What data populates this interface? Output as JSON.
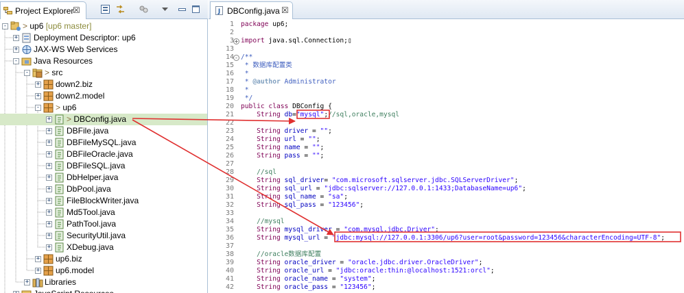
{
  "explorer": {
    "tab_title": "Project Explorer",
    "tab_close": "☒",
    "tree": [
      {
        "label": "up6",
        "suffix": " [up6 master]",
        "prefix": "> ",
        "icon": "project-icon",
        "expander": "-",
        "level": 0
      },
      {
        "label": "Deployment Descriptor: up6",
        "icon": "deployment-descriptor-icon",
        "expander": "+",
        "level": 1
      },
      {
        "label": "JAX-WS Web Services",
        "icon": "web-services-icon",
        "expander": "+",
        "level": 1
      },
      {
        "label": "Java Resources",
        "icon": "java-resources-icon",
        "expander": "-",
        "level": 1
      },
      {
        "label": "src",
        "prefix": "> ",
        "icon": "source-folder-icon",
        "expander": "-",
        "level": 2
      },
      {
        "label": "down2.biz",
        "icon": "package-icon",
        "expander": "+",
        "level": 3
      },
      {
        "label": "down2.model",
        "icon": "package-icon",
        "expander": "+",
        "level": 3
      },
      {
        "label": "up6",
        "prefix": "> ",
        "icon": "package-icon",
        "expander": "-",
        "level": 3
      },
      {
        "label": "DBConfig.java",
        "prefix": "> ",
        "icon": "java-file-icon",
        "expander": "+",
        "level": 4,
        "selected": true
      },
      {
        "label": "DBFile.java",
        "icon": "java-file-icon",
        "expander": "+",
        "level": 4
      },
      {
        "label": "DBFileMySQL.java",
        "icon": "java-file-icon",
        "expander": "+",
        "level": 4
      },
      {
        "label": "DBFileOracle.java",
        "icon": "java-file-icon",
        "expander": "+",
        "level": 4
      },
      {
        "label": "DBFileSQL.java",
        "icon": "java-file-icon",
        "expander": "+",
        "level": 4
      },
      {
        "label": "DbHelper.java",
        "icon": "java-file-icon",
        "expander": "+",
        "level": 4
      },
      {
        "label": "DbPool.java",
        "icon": "java-file-icon",
        "expander": "+",
        "level": 4
      },
      {
        "label": "FileBlockWriter.java",
        "icon": "java-file-icon",
        "expander": "+",
        "level": 4
      },
      {
        "label": "Md5Tool.java",
        "icon": "java-file-icon",
        "expander": "+",
        "level": 4
      },
      {
        "label": "PathTool.java",
        "icon": "java-file-icon",
        "expander": "+",
        "level": 4
      },
      {
        "label": "SecurityUtil.java",
        "icon": "java-file-icon",
        "expander": "+",
        "level": 4
      },
      {
        "label": "XDebug.java",
        "icon": "java-file-icon",
        "expander": "+",
        "level": 4
      },
      {
        "label": "up6.biz",
        "icon": "package-icon",
        "expander": "+",
        "level": 3
      },
      {
        "label": "up6.model",
        "icon": "package-icon",
        "expander": "+",
        "level": 3
      },
      {
        "label": "Libraries",
        "icon": "libraries-icon",
        "expander": "+",
        "level": 2
      },
      {
        "label": "JavaScript Resources",
        "icon": "javascript-resources-icon",
        "expander": "+",
        "level": 1
      }
    ]
  },
  "editor": {
    "tab_title": "DBConfig.java",
    "tab_close": "☒",
    "lines": [
      {
        "n": "1",
        "tokens": [
          [
            "kw",
            "package"
          ],
          [
            "tx",
            " up6;"
          ]
        ]
      },
      {
        "n": "2",
        "tokens": []
      },
      {
        "n": "3",
        "fold": "+",
        "tokens": [
          [
            "kw",
            "import"
          ],
          [
            "tx",
            " java.sql.Connection;"
          ],
          [
            "tx",
            "▯"
          ]
        ]
      },
      {
        "n": "13",
        "tokens": []
      },
      {
        "n": "14",
        "fold": "-",
        "tokens": [
          [
            "jd",
            "/**"
          ]
        ]
      },
      {
        "n": "15",
        "tokens": [
          [
            "jd",
            " * 数据库配置类"
          ]
        ]
      },
      {
        "n": "16",
        "tokens": [
          [
            "jd",
            " *"
          ]
        ]
      },
      {
        "n": "17",
        "tokens": [
          [
            "jd",
            " * "
          ],
          [
            "ann",
            "@author"
          ],
          [
            "jd",
            " Administrator"
          ]
        ]
      },
      {
        "n": "18",
        "tokens": [
          [
            "jd",
            " *"
          ]
        ]
      },
      {
        "n": "19",
        "tokens": [
          [
            "jd",
            " */"
          ]
        ]
      },
      {
        "n": "20",
        "tokens": [
          [
            "kw",
            "public class"
          ],
          [
            "tx",
            " DBConfig {"
          ]
        ]
      },
      {
        "n": "21",
        "tokens": [
          [
            "tx",
            "    "
          ],
          [
            "kw",
            "String"
          ],
          [
            "fld",
            " db"
          ],
          [
            "tx",
            "="
          ],
          [
            "str",
            "\"mysql\""
          ],
          [
            "tx",
            ";"
          ],
          [
            "cm",
            "//sql,oracle,mysql"
          ]
        ]
      },
      {
        "n": "22",
        "tokens": []
      },
      {
        "n": "23",
        "tokens": [
          [
            "tx",
            "    "
          ],
          [
            "kw",
            "String"
          ],
          [
            "fld",
            " driver"
          ],
          [
            "tx",
            " = "
          ],
          [
            "str",
            "\"\""
          ],
          [
            "tx",
            ";"
          ]
        ]
      },
      {
        "n": "24",
        "tokens": [
          [
            "tx",
            "    "
          ],
          [
            "kw",
            "String"
          ],
          [
            "fld",
            " url"
          ],
          [
            "tx",
            " = "
          ],
          [
            "str",
            "\"\""
          ],
          [
            "tx",
            ";"
          ]
        ]
      },
      {
        "n": "25",
        "tokens": [
          [
            "tx",
            "    "
          ],
          [
            "kw",
            "String"
          ],
          [
            "fld",
            " name"
          ],
          [
            "tx",
            " = "
          ],
          [
            "str",
            "\"\""
          ],
          [
            "tx",
            ";"
          ]
        ]
      },
      {
        "n": "26",
        "tokens": [
          [
            "tx",
            "    "
          ],
          [
            "kw",
            "String"
          ],
          [
            "fld",
            " pass"
          ],
          [
            "tx",
            " = "
          ],
          [
            "str",
            "\"\""
          ],
          [
            "tx",
            ";"
          ]
        ]
      },
      {
        "n": "27",
        "tokens": []
      },
      {
        "n": "28",
        "tokens": [
          [
            "cm",
            "    //sql"
          ]
        ]
      },
      {
        "n": "29",
        "tokens": [
          [
            "tx",
            "    "
          ],
          [
            "kw",
            "String"
          ],
          [
            "fld",
            " sql_driver"
          ],
          [
            "tx",
            "= "
          ],
          [
            "str",
            "\"com.microsoft.sqlserver.jdbc.SQLServerDriver\""
          ],
          [
            "tx",
            ";"
          ]
        ]
      },
      {
        "n": "30",
        "tokens": [
          [
            "tx",
            "    "
          ],
          [
            "kw",
            "String"
          ],
          [
            "fld",
            " sql_url"
          ],
          [
            "tx",
            " = "
          ],
          [
            "str",
            "\"jdbc:sqlserver://127.0.0.1:1433;DatabaseName=up6\""
          ],
          [
            "tx",
            ";"
          ]
        ]
      },
      {
        "n": "31",
        "tokens": [
          [
            "tx",
            "    "
          ],
          [
            "kw",
            "String"
          ],
          [
            "fld",
            " sql_name"
          ],
          [
            "tx",
            " = "
          ],
          [
            "str",
            "\"sa\""
          ],
          [
            "tx",
            ";"
          ]
        ]
      },
      {
        "n": "32",
        "tokens": [
          [
            "tx",
            "    "
          ],
          [
            "kw",
            "String"
          ],
          [
            "fld",
            " sql_pass"
          ],
          [
            "tx",
            " = "
          ],
          [
            "str",
            "\"123456\""
          ],
          [
            "tx",
            ";"
          ]
        ]
      },
      {
        "n": "33",
        "tokens": []
      },
      {
        "n": "34",
        "tokens": [
          [
            "cm",
            "    //mysql"
          ]
        ]
      },
      {
        "n": "35",
        "tokens": [
          [
            "tx",
            "    "
          ],
          [
            "kw",
            "String"
          ],
          [
            "fld",
            " mysql_driver"
          ],
          [
            "tx",
            " = "
          ],
          [
            "str",
            "\"com.mysql.jdbc.Driver\""
          ],
          [
            "tx",
            ";"
          ]
        ]
      },
      {
        "n": "36",
        "tokens": [
          [
            "tx",
            "    "
          ],
          [
            "kw",
            "String"
          ],
          [
            "fld",
            " mysql_url"
          ],
          [
            "tx",
            " = "
          ],
          [
            "str",
            "\"jdbc:mysql://127.0.0.1:3306/up6?user=root&password=123456&characterEncoding=UTF-8\""
          ],
          [
            "tx",
            ";"
          ]
        ]
      },
      {
        "n": "37",
        "tokens": []
      },
      {
        "n": "38",
        "tokens": [
          [
            "cm",
            "    //oracle数据库配置"
          ]
        ]
      },
      {
        "n": "39",
        "tokens": [
          [
            "tx",
            "    "
          ],
          [
            "kw",
            "String"
          ],
          [
            "fld",
            " oracle_driver"
          ],
          [
            "tx",
            " = "
          ],
          [
            "str",
            "\"oracle.jdbc.driver.OracleDriver\""
          ],
          [
            "tx",
            ";"
          ]
        ]
      },
      {
        "n": "40",
        "tokens": [
          [
            "tx",
            "    "
          ],
          [
            "kw",
            "String"
          ],
          [
            "fld",
            " oracle_url"
          ],
          [
            "tx",
            " = "
          ],
          [
            "str",
            "\"jdbc:oracle:thin:@localhost:1521:orcl\""
          ],
          [
            "tx",
            ";"
          ]
        ]
      },
      {
        "n": "41",
        "tokens": [
          [
            "tx",
            "    "
          ],
          [
            "kw",
            "String"
          ],
          [
            "fld",
            " oracle_name"
          ],
          [
            "tx",
            " = "
          ],
          [
            "str",
            "\"system\""
          ],
          [
            "tx",
            ";"
          ]
        ]
      },
      {
        "n": "42",
        "tokens": [
          [
            "tx",
            "    "
          ],
          [
            "kw",
            "String"
          ],
          [
            "fld",
            " oracle_pass"
          ],
          [
            "tx",
            " = "
          ],
          [
            "str",
            "\"123456\""
          ],
          [
            "tx",
            ";"
          ]
        ]
      }
    ]
  },
  "colors": {
    "selection": "#d7e9c8",
    "annotation_red": "#e03030",
    "keyword": "#7f0055",
    "string": "#2a00ff",
    "comment": "#3f7f5f",
    "javadoc": "#3f5fbf",
    "field": "#0000c0"
  }
}
